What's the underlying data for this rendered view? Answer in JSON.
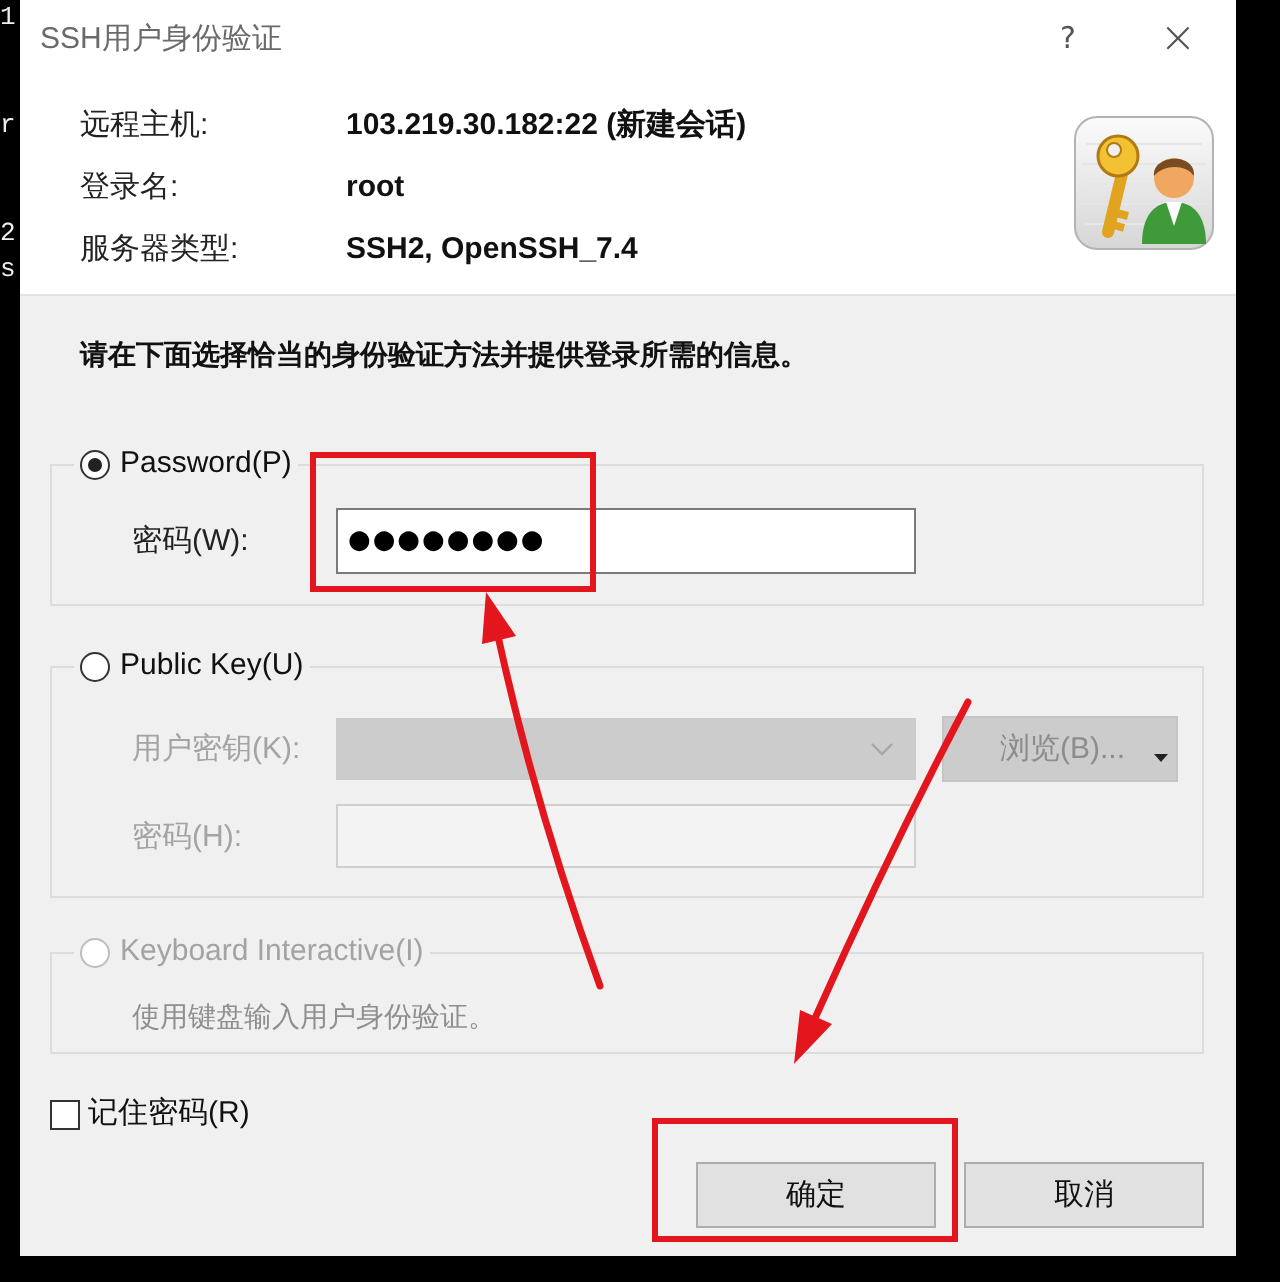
{
  "terminal_edge": [
    "1",
    "r",
    "2",
    "s"
  ],
  "window": {
    "title": "SSH用户身份验证",
    "help_button": "?",
    "close_button": "×"
  },
  "connection_info": [
    {
      "label": "远程主机:",
      "value": "103.219.30.182:22 (新建会话)"
    },
    {
      "label": "登录名:",
      "value": "root"
    },
    {
      "label": "服务器类型:",
      "value": "SSH2, OpenSSH_7.4"
    }
  ],
  "instruction": "请在下面选择恰当的身份验证方法并提供登录所需的信息。",
  "methods": [
    {
      "kind": "password",
      "label": "Password(P)",
      "selected": true,
      "disabled": false,
      "fields": [
        {
          "kind": "password",
          "label": "密码(W):",
          "value": "●●●●●●●●",
          "disabled": false
        }
      ]
    },
    {
      "kind": "publickey",
      "label": "Public Key(U)",
      "selected": false,
      "disabled": false,
      "fields": [
        {
          "kind": "combo",
          "label": "用户密钥(K):",
          "disabled": true,
          "button": {
            "label": "浏览(B)...",
            "disabled": true
          }
        },
        {
          "kind": "input",
          "label": "密码(H):",
          "disabled": true
        }
      ]
    },
    {
      "kind": "keyboard",
      "label": "Keyboard Interactive(I)",
      "selected": false,
      "disabled": true,
      "description": "使用键盘输入用户身份验证。"
    }
  ],
  "remember_password": {
    "label": "记住密码(R)",
    "checked": false
  },
  "buttons": [
    {
      "label": "确定"
    },
    {
      "label": "取消"
    }
  ]
}
